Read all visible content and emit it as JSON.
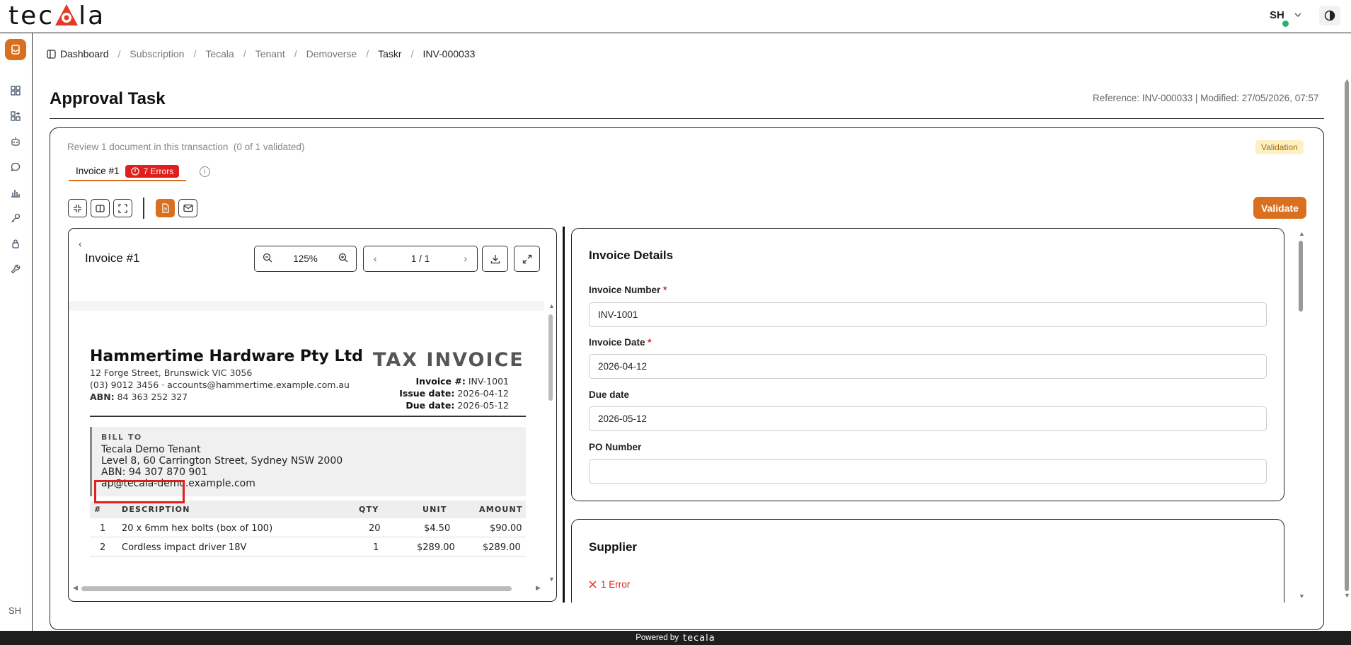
{
  "app": {
    "logo_text": "tecala",
    "user_initials": "SH",
    "brand_color": "#d97020",
    "error_color": "#e01f1f"
  },
  "breadcrumb": [
    "Dashboard",
    "Subscription",
    "Tecala",
    "Tenant",
    "Demoverse",
    "Taskr",
    "INV-000033"
  ],
  "page": {
    "title": "Approval Task",
    "reference": "Reference: INV-000033 | Modified: 27/05/2026, 07:57",
    "review_text": "Review 1 document in this transaction  (0 of 1 validated)",
    "status_badge": "Validation",
    "doc_tab_label": "Invoice #1",
    "doc_tab_errors": "7 Errors",
    "validate_label": "Validate"
  },
  "viewer": {
    "title": "Invoice #1",
    "zoom": "125%",
    "page_indicator": "1 / 1"
  },
  "invoice_doc": {
    "company": "Hammertime Hardware Pty Ltd",
    "doc_type": "TAX INVOICE",
    "address": "12 Forge Street, Brunswick VIC 3056",
    "contact": "(03) 9012 3456 · accounts@hammertime.example.com.au",
    "abn_label": "ABN:",
    "abn_value": "84 363 252 327",
    "invoice_no_label": "Invoice #:",
    "invoice_no": "INV-1001",
    "issue_label": "Issue date:",
    "issue_date": "2026-04-12",
    "due_label": "Due date:",
    "due_date": "2026-05-12",
    "bill_to_heading": "BILL TO",
    "bill_to_name": "Tecala Demo Tenant",
    "bill_to_address": "Level 8, 60 Carrington Street, Sydney NSW 2000",
    "bill_to_abn": "ABN: 94 307 870 901",
    "bill_to_email": "ap@tecala-demo.example.com",
    "table_headers": [
      "#",
      "DESCRIPTION",
      "QTY",
      "UNIT",
      "AMOUNT"
    ],
    "rows": [
      {
        "num": "1",
        "desc": "20 x 6mm hex bolts (box of 100)",
        "qty": "20",
        "unit": "$4.50",
        "amount": "$90.00"
      },
      {
        "num": "2",
        "desc": "Cordless impact driver 18V",
        "qty": "1",
        "unit": "$289.00",
        "amount": "$289.00"
      }
    ]
  },
  "invoice_details": {
    "title": "Invoice Details",
    "invoice_number_label": "Invoice Number",
    "invoice_number": "INV-1001",
    "invoice_date_label": "Invoice Date",
    "invoice_date": "2026-04-12",
    "due_date_label": "Due date",
    "due_date": "2026-05-12",
    "po_label": "PO Number",
    "po_value": "",
    "required_marker": "*"
  },
  "supplier": {
    "title": "Supplier",
    "error_text": "1 Error"
  },
  "footer": {
    "powered_by": "Powered by",
    "logo": "tecala"
  }
}
